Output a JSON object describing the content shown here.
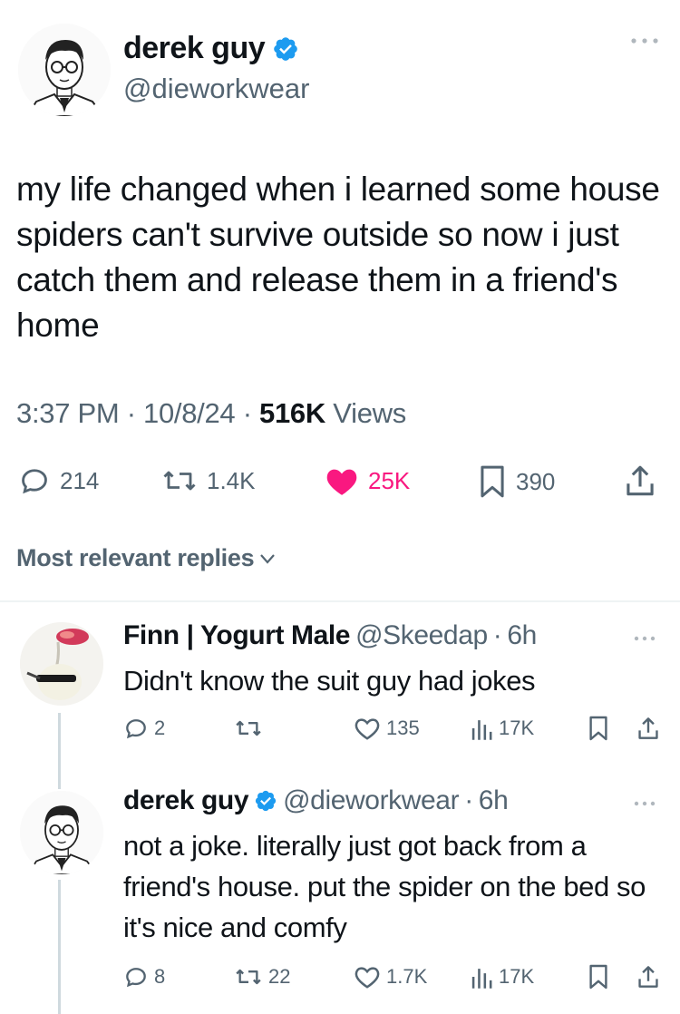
{
  "main_tweet": {
    "author_name": "derek guy",
    "author_handle": "@dieworkwear",
    "text": "my life changed when i learned some house spiders can't survive outside so now i just catch them and release them in a friend's home",
    "time": "3:37 PM",
    "date": "10/8/24",
    "views_count": "516K",
    "views_label": "Views",
    "actions": {
      "replies": "214",
      "reposts": "1.4K",
      "likes": "25K",
      "bookmarks": "390"
    }
  },
  "replies_sort_label": "Most relevant replies",
  "replies": [
    {
      "author_name": "Finn | Yogurt Male",
      "author_handle": "@Skeedap",
      "age": "6h",
      "text": "Didn't know the suit guy had jokes",
      "actions": {
        "replies": "2",
        "reposts": "",
        "likes": "135",
        "views": "17K"
      }
    },
    {
      "author_name": "derek guy",
      "author_handle": "@dieworkwear",
      "age": "6h",
      "text": "not a joke. literally just got back from a friend's house. put the spider on the bed so it's nice and comfy",
      "actions": {
        "replies": "8",
        "reposts": "22",
        "likes": "1.7K",
        "views": "17K"
      }
    }
  ],
  "colors": {
    "verified_blue": "#1d9bf0",
    "like_pink": "#f91880",
    "secondary_text": "#536471"
  }
}
